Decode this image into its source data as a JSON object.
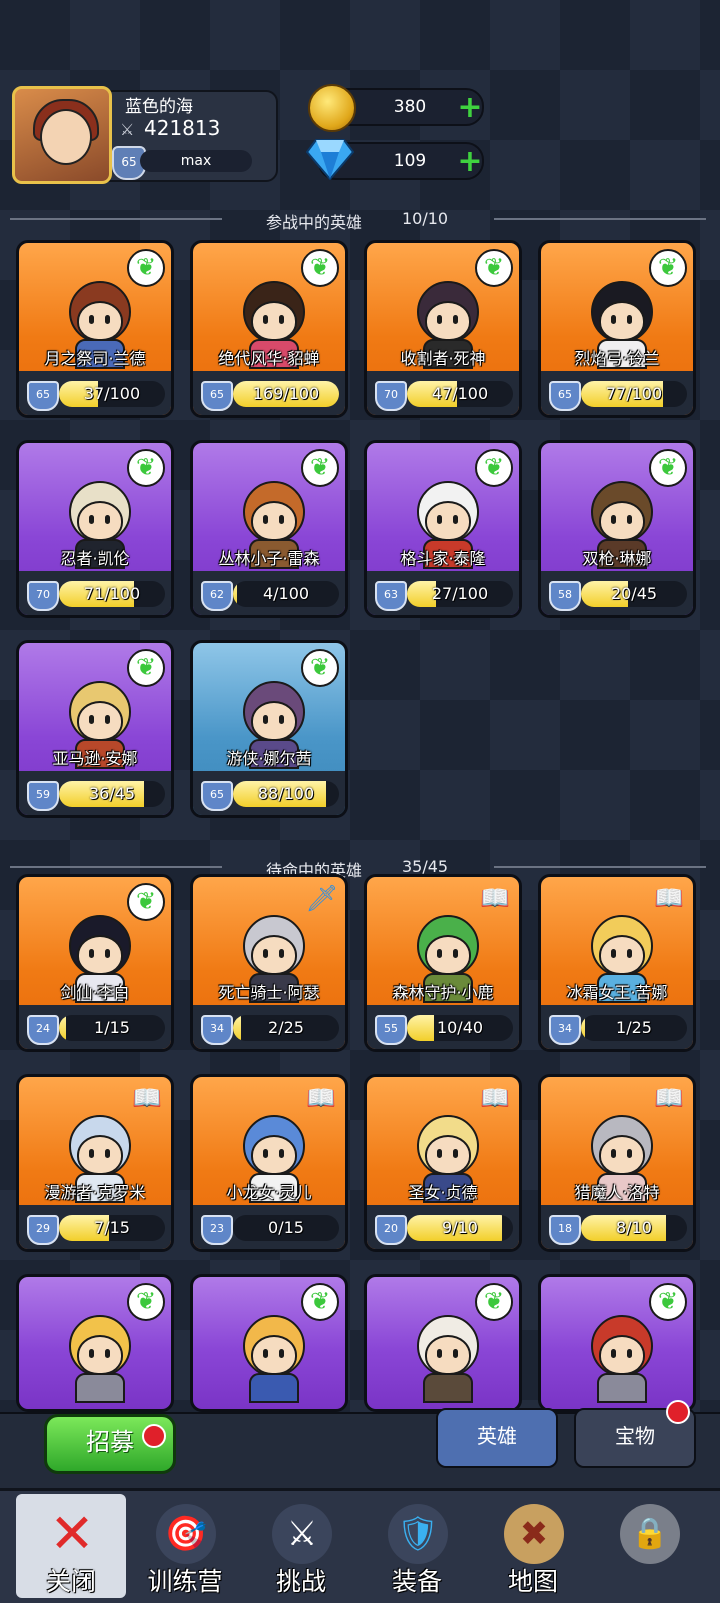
{
  "player": {
    "name": "蓝色的海",
    "power": "421813",
    "level": "65",
    "level_status": "max"
  },
  "currency": {
    "gold": "380",
    "gems": "109"
  },
  "active_section": {
    "title": "参战中的英雄",
    "count": "10/10"
  },
  "standby_section": {
    "title": "待命中的英雄",
    "count": "35/45"
  },
  "active_heroes": [
    {
      "name": "月之祭司·兰德",
      "level": "65",
      "progress": "37/100",
      "fill": 0.37,
      "bg": "orange",
      "badge": "wing",
      "hair": "#8a3a20",
      "body": "#4a6ab8"
    },
    {
      "name": "绝代风华·貂蝉",
      "level": "65",
      "progress": "169/100",
      "fill": 1.0,
      "bg": "orange",
      "badge": "wing",
      "hair": "#3a2418",
      "body": "#d84a6a"
    },
    {
      "name": "收割者·死神",
      "level": "70",
      "progress": "47/100",
      "fill": 0.47,
      "bg": "orange",
      "badge": "wing",
      "hair": "#3a2a3a",
      "body": "#2a2a2a"
    },
    {
      "name": "烈焰弓·铃兰",
      "level": "65",
      "progress": "77/100",
      "fill": 0.77,
      "bg": "orange",
      "badge": "wing",
      "hair": "#1a1a22",
      "body": "#f0eef0"
    },
    {
      "name": "忍者·凯伦",
      "level": "70",
      "progress": "71/100",
      "fill": 0.71,
      "bg": "purple",
      "badge": "wing",
      "hair": "#e8e0c8",
      "body": "#20242e"
    },
    {
      "name": "丛林小子·雷森",
      "level": "62",
      "progress": "4/100",
      "fill": 0.04,
      "bg": "purple",
      "badge": "wing",
      "hair": "#c46a2a",
      "body": "#8a5a30"
    },
    {
      "name": "格斗家·泰隆",
      "level": "63",
      "progress": "27/100",
      "fill": 0.27,
      "bg": "purple",
      "badge": "wing",
      "hair": "#f2f2f2",
      "body": "#c83a2a"
    },
    {
      "name": "双枪·琳娜",
      "level": "58",
      "progress": "20/45",
      "fill": 0.44,
      "bg": "purple",
      "badge": "wing",
      "hair": "#6a4a2a",
      "body": "#5a3a28"
    },
    {
      "name": "亚马逊·安娜",
      "level": "59",
      "progress": "36/45",
      "fill": 0.8,
      "bg": "purple",
      "badge": "wing",
      "hair": "#e8c870",
      "body": "#b8482a"
    },
    {
      "name": "游侠·娜尔茜",
      "level": "65",
      "progress": "88/100",
      "fill": 0.88,
      "bg": "blue",
      "badge": "wing",
      "hair": "#6a4a7a",
      "body": "#5a4a8a"
    }
  ],
  "standby_heroes": [
    {
      "name": "剑仙·李白",
      "level": "24",
      "progress": "1/15",
      "fill": 0.07,
      "bg": "orange",
      "badge": "wing",
      "hair": "#1a1a2a",
      "body": "#e8e8f0"
    },
    {
      "name": "死亡骑士·阿瑟",
      "level": "34",
      "progress": "2/25",
      "fill": 0.08,
      "bg": "orange",
      "badge": "sword",
      "hair": "#c8c8d0",
      "body": "#3a3a4a"
    },
    {
      "name": "森林守护·小鹿",
      "level": "55",
      "progress": "10/40",
      "fill": 0.25,
      "bg": "orange",
      "badge": "book",
      "hair": "#4ab04a",
      "body": "#6a8a3a"
    },
    {
      "name": "冰霜女王·苦娜",
      "level": "34",
      "progress": "1/25",
      "fill": 0.04,
      "bg": "orange",
      "badge": "book",
      "hair": "#f2cc5a",
      "body": "#5ab0e0"
    },
    {
      "name": "漫游者·克罗米",
      "level": "29",
      "progress": "7/15",
      "fill": 0.47,
      "bg": "orange",
      "badge": "book",
      "hair": "#c8d8ec",
      "body": "#e0e8f2"
    },
    {
      "name": "小龙女·灵儿",
      "level": "23",
      "progress": "0/15",
      "fill": 0.0,
      "bg": "orange",
      "badge": "book",
      "hair": "#5a8ad8",
      "body": "#f2f2f2"
    },
    {
      "name": "圣女·贞德",
      "level": "20",
      "progress": "9/10",
      "fill": 0.9,
      "bg": "orange",
      "badge": "book",
      "hair": "#f2dc8a",
      "body": "#3a4a8a"
    },
    {
      "name": "猎魔人·洛特",
      "level": "18",
      "progress": "8/10",
      "fill": 0.8,
      "bg": "orange",
      "badge": "book",
      "hair": "#b8b8c0",
      "body": "#e8c8c8"
    },
    {
      "name": "",
      "level": "",
      "progress": "",
      "fill": 0,
      "bg": "purple",
      "badge": "wing",
      "hair": "#f2c24a",
      "body": "#8a8a9a"
    },
    {
      "name": "",
      "level": "",
      "progress": "",
      "fill": 0,
      "bg": "purple",
      "badge": "wing",
      "hair": "#f2b84a",
      "body": "#3a5ab0"
    },
    {
      "name": "",
      "level": "",
      "progress": "",
      "fill": 0,
      "bg": "purple",
      "badge": "wing",
      "hair": "#f0ece4",
      "body": "#5a4a3a"
    },
    {
      "name": "",
      "level": "",
      "progress": "",
      "fill": 0,
      "bg": "purple",
      "badge": "wing",
      "hair": "#c83a2a",
      "body": "#8a8a9a"
    }
  ],
  "buttons": {
    "recruit": "招募"
  },
  "tabs": {
    "hero": "英雄",
    "treasure": "宝物"
  },
  "nav": [
    {
      "label": "关闭",
      "icon": "close-icon"
    },
    {
      "label": "训练营",
      "icon": "target-icon"
    },
    {
      "label": "挑战",
      "icon": "sword-icon"
    },
    {
      "label": "装备",
      "icon": "armor-icon"
    },
    {
      "label": "地图",
      "icon": "map-icon"
    },
    {
      "label": "",
      "icon": "locked-icon"
    }
  ]
}
